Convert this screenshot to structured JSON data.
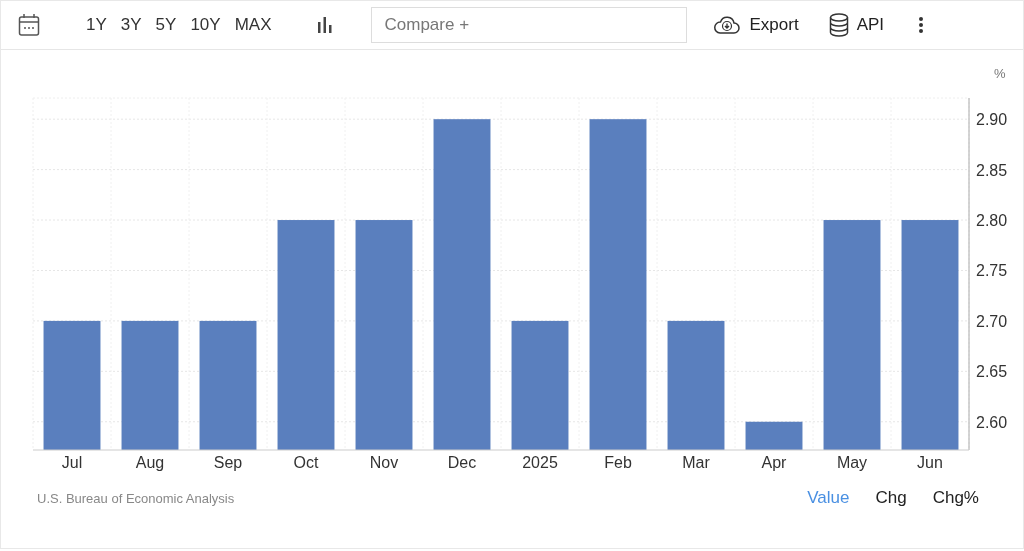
{
  "toolbar": {
    "ranges": [
      "1Y",
      "3Y",
      "5Y",
      "10Y",
      "MAX"
    ],
    "compare": {
      "placeholder": "Compare +"
    },
    "export": "Export",
    "api": "API"
  },
  "chart": {
    "unit": "%",
    "chart_data": {
      "type": "bar",
      "categories": [
        "Jul",
        "Aug",
        "Sep",
        "Oct",
        "Nov",
        "Dec",
        "2025",
        "Feb",
        "Mar",
        "Apr",
        "May",
        "Jun"
      ],
      "grid": true,
      "series": [
        {
          "color": "#5a7fbe",
          "values": [
            2.7,
            2.7,
            2.7,
            2.8,
            2.8,
            2.9,
            2.7,
            2.9,
            2.7,
            2.6,
            2.8,
            2.8
          ]
        }
      ],
      "ylim": [
        2.572,
        2.921
      ],
      "yticks": [
        {
          "value": 2.6,
          "label": "2.60"
        },
        {
          "value": 2.65,
          "label": "2.65"
        },
        {
          "value": 2.7,
          "label": "2.70"
        },
        {
          "value": 2.75,
          "label": "2.75"
        },
        {
          "value": 2.8,
          "label": "2.80"
        },
        {
          "value": 2.85,
          "label": "2.85"
        },
        {
          "value": 2.9,
          "label": "2.90"
        }
      ]
    }
  },
  "footer": {
    "source": "U.S. Bureau of Economic Analysis",
    "tabs": [
      {
        "label": "Value",
        "selected": true
      },
      {
        "label": "Chg",
        "selected": false
      },
      {
        "label": "Chg%",
        "selected": false
      }
    ]
  }
}
